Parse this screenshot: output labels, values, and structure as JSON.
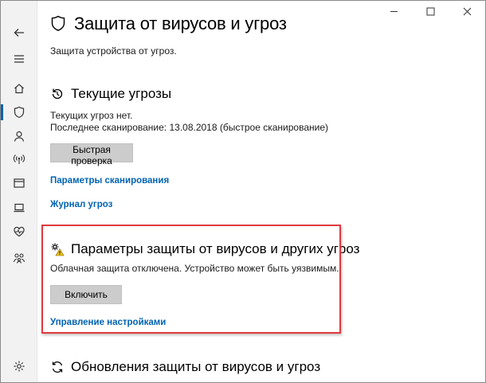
{
  "window": {
    "controls": [
      "minimize",
      "maximize",
      "close"
    ]
  },
  "rail": {
    "items": [
      {
        "icon": "back-arrow-icon"
      },
      {
        "icon": "hamburger-menu-icon"
      },
      {
        "icon": "home-icon"
      },
      {
        "icon": "shield-icon"
      },
      {
        "icon": "person-icon"
      },
      {
        "icon": "wireless-icon"
      },
      {
        "icon": "app-browser-icon"
      },
      {
        "icon": "laptop-icon"
      },
      {
        "icon": "heart-icon"
      },
      {
        "icon": "family-icon"
      },
      {
        "icon": "gear-icon"
      }
    ],
    "active_color": "#0063b1"
  },
  "page": {
    "title": "Защита от вирусов и угроз",
    "subtitle": "Защита устройства от угроз."
  },
  "current_threats": {
    "title": "Текущие угрозы",
    "status": "Текущих угроз нет.",
    "last_scan": "Последнее сканирование: 13.08.2018 (быстрое сканирование)",
    "quick_scan_button": "Быстрая проверка",
    "scan_options_link": "Параметры сканирования",
    "threat_history_link": "Журнал угроз"
  },
  "protection_settings": {
    "title": "Параметры защиты от вирусов и других угроз",
    "status": "Облачная защита отключена. Устройство может быть уязвимым.",
    "enable_button": "Включить",
    "manage_link": "Управление настройками",
    "highlight_color": "#e0393e"
  },
  "updates": {
    "title": "Обновления защиты от вирусов и угроз"
  },
  "colors": {
    "link": "#0063b1",
    "button_bg": "#cccccc"
  }
}
